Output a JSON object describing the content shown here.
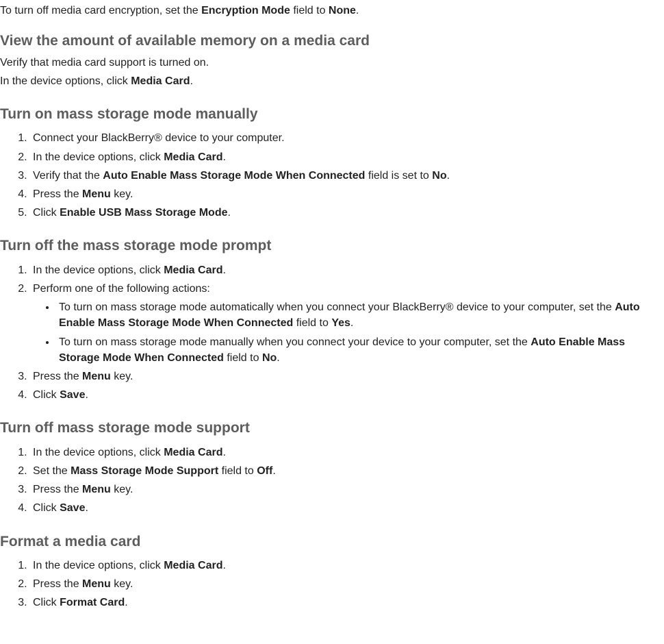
{
  "intro_line": {
    "pre": "To turn off media card encryption, set the ",
    "b1": "Encryption Mode",
    "mid": " field to ",
    "b2": "None",
    "post": "."
  },
  "s1": {
    "heading": "View the amount of available memory on a media card",
    "p1": "Verify that media card support is turned on.",
    "p2": {
      "pre": "In the device options, click ",
      "b": "Media Card",
      "post": "."
    }
  },
  "s2": {
    "heading": "Turn on mass storage mode manually",
    "items": [
      {
        "text": "Connect your BlackBerry® device to your computer."
      },
      {
        "pre": "In the device options, click ",
        "b": "Media Card",
        "post": "."
      },
      {
        "pre": "Verify that the ",
        "b": "Auto Enable Mass Storage Mode When Connected",
        "mid": " field is set to ",
        "b2": "No",
        "post": "."
      },
      {
        "pre": "Press the ",
        "b": "Menu",
        "post": " key."
      },
      {
        "pre": "Click ",
        "b": "Enable USB Mass Storage Mode",
        "post": "."
      }
    ]
  },
  "s3": {
    "heading": "Turn off the mass storage mode prompt",
    "items12": [
      {
        "pre": "In the device options, click ",
        "b": "Media Card",
        "post": "."
      },
      {
        "text": "Perform one of the following actions:"
      }
    ],
    "sub": [
      {
        "pre": "To turn on mass storage mode automatically when you connect your BlackBerry® device to your computer, set the ",
        "b": "Auto Enable Mass Storage Mode When Connected",
        "mid": " field to ",
        "b2": "Yes",
        "post": "."
      },
      {
        "pre": "To turn on mass storage mode manually when you connect your device to your computer, set the ",
        "b": "Auto Enable Mass Storage Mode When Connected",
        "mid": " field to ",
        "b2": "No",
        "post": "."
      }
    ],
    "items34": [
      {
        "pre": "Press the ",
        "b": "Menu",
        "post": " key."
      },
      {
        "pre": "Click ",
        "b": "Save",
        "post": "."
      }
    ]
  },
  "s4": {
    "heading": "Turn off mass storage mode support",
    "items": [
      {
        "pre": "In the device options, click ",
        "b": "Media Card",
        "post": "."
      },
      {
        "pre": "Set the ",
        "b": "Mass Storage Mode Support",
        "mid": " field to ",
        "b2": "Off",
        "post": "."
      },
      {
        "pre": "Press the ",
        "b": "Menu",
        "post": " key."
      },
      {
        "pre": "Click ",
        "b": "Save",
        "post": "."
      }
    ]
  },
  "s5": {
    "heading": "Format a media card",
    "items": [
      {
        "pre": "In the device options, click ",
        "b": "Media Card",
        "post": "."
      },
      {
        "pre": "Press the ",
        "b": "Menu",
        "post": " key."
      },
      {
        "pre": "Click ",
        "b": "Format Card",
        "post": "."
      }
    ]
  }
}
